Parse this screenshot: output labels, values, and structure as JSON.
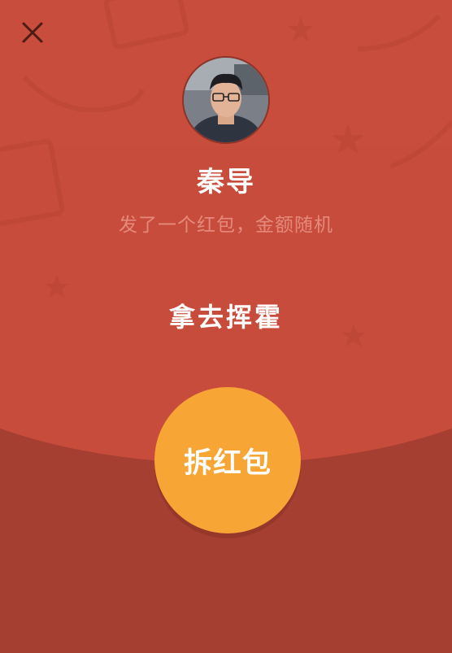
{
  "close": {
    "icon": "close-icon"
  },
  "sender": {
    "name": "秦导",
    "avatar_icon": "avatar-photo"
  },
  "subtitle": "发了一个红包，金额随机",
  "message": "拿去挥霍",
  "open_button": {
    "label": "拆红包"
  },
  "colors": {
    "top": "#c94d3c",
    "bottom": "#a53f32",
    "button": "#f7a535",
    "subtitle": "#e48a7c"
  }
}
